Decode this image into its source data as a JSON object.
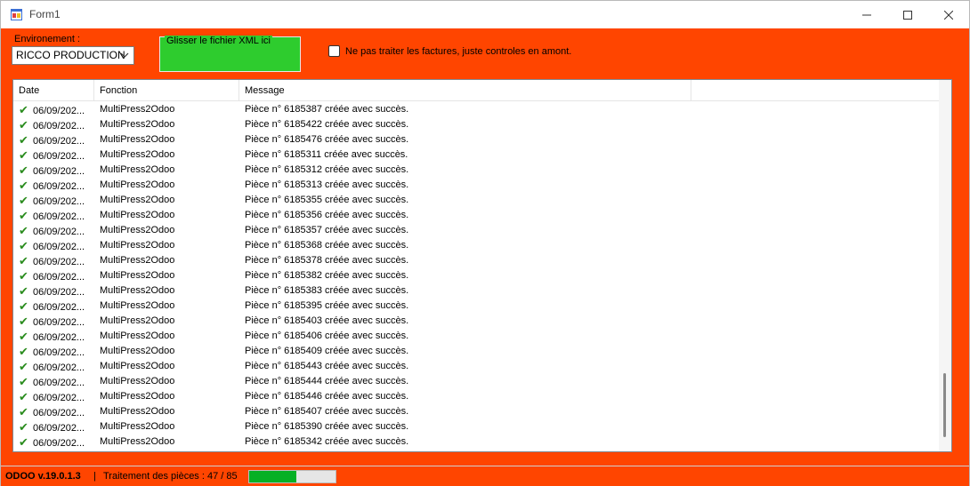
{
  "window": {
    "title": "Form1"
  },
  "controls": {
    "environment_label": "Environement :",
    "environment_value": "RICCO PRODUCTION",
    "drop_zone_label": "Glisser le fichier XML ici",
    "checkbox_label": "Ne pas traiter les factures, juste controles en amont."
  },
  "log_table": {
    "columns": [
      "Date",
      "Fonction",
      "Message"
    ],
    "rows": [
      {
        "date": "06/09/202...",
        "function": "MultiPress2Odoo",
        "message": "Pièce n° 6185387 créée avec succès."
      },
      {
        "date": "06/09/202...",
        "function": "MultiPress2Odoo",
        "message": "Pièce n° 6185422 créée avec succès."
      },
      {
        "date": "06/09/202...",
        "function": "MultiPress2Odoo",
        "message": "Pièce n° 6185476 créée avec succès."
      },
      {
        "date": "06/09/202...",
        "function": "MultiPress2Odoo",
        "message": "Pièce n° 6185311 créée avec succès."
      },
      {
        "date": "06/09/202...",
        "function": "MultiPress2Odoo",
        "message": "Pièce n° 6185312 créée avec succès."
      },
      {
        "date": "06/09/202...",
        "function": "MultiPress2Odoo",
        "message": "Pièce n° 6185313 créée avec succès."
      },
      {
        "date": "06/09/202...",
        "function": "MultiPress2Odoo",
        "message": "Pièce n° 6185355 créée avec succès."
      },
      {
        "date": "06/09/202...",
        "function": "MultiPress2Odoo",
        "message": "Pièce n° 6185356 créée avec succès."
      },
      {
        "date": "06/09/202...",
        "function": "MultiPress2Odoo",
        "message": "Pièce n° 6185357 créée avec succès."
      },
      {
        "date": "06/09/202...",
        "function": "MultiPress2Odoo",
        "message": "Pièce n° 6185368 créée avec succès."
      },
      {
        "date": "06/09/202...",
        "function": "MultiPress2Odoo",
        "message": "Pièce n° 6185378 créée avec succès."
      },
      {
        "date": "06/09/202...",
        "function": "MultiPress2Odoo",
        "message": "Pièce n° 6185382 créée avec succès."
      },
      {
        "date": "06/09/202...",
        "function": "MultiPress2Odoo",
        "message": "Pièce n° 6185383 créée avec succès."
      },
      {
        "date": "06/09/202...",
        "function": "MultiPress2Odoo",
        "message": "Pièce n° 6185395 créée avec succès."
      },
      {
        "date": "06/09/202...",
        "function": "MultiPress2Odoo",
        "message": "Pièce n° 6185403 créée avec succès."
      },
      {
        "date": "06/09/202...",
        "function": "MultiPress2Odoo",
        "message": "Pièce n° 6185406 créée avec succès."
      },
      {
        "date": "06/09/202...",
        "function": "MultiPress2Odoo",
        "message": "Pièce n° 6185409 créée avec succès."
      },
      {
        "date": "06/09/202...",
        "function": "MultiPress2Odoo",
        "message": "Pièce n° 6185443 créée avec succès."
      },
      {
        "date": "06/09/202...",
        "function": "MultiPress2Odoo",
        "message": "Pièce n° 6185444 créée avec succès."
      },
      {
        "date": "06/09/202...",
        "function": "MultiPress2Odoo",
        "message": "Pièce n° 6185446 créée avec succès."
      },
      {
        "date": "06/09/202...",
        "function": "MultiPress2Odoo",
        "message": "Pièce n° 6185407 créée avec succès."
      },
      {
        "date": "06/09/202...",
        "function": "MultiPress2Odoo",
        "message": "Pièce n° 6185390 créée avec succès."
      },
      {
        "date": "06/09/202...",
        "function": "MultiPress2Odoo",
        "message": "Pièce n° 6185342 créée avec succès."
      }
    ],
    "row_icon": "checkmark-icon"
  },
  "status": {
    "version": "ODOO v.19.0.1.3",
    "separator": "|",
    "progress_text": "Traitement des pièces : 47 / 85",
    "progress_fraction": 0.55
  },
  "colors": {
    "background": "#ff4500",
    "drop_zone": "#2ecc2e",
    "check": "#2a8c1e",
    "progress": "#06b025"
  },
  "icons": {
    "app": "app-window-icon",
    "minimize": "minimize-icon",
    "maximize": "maximize-icon",
    "close": "close-icon",
    "dropdown": "chevron-down-icon"
  }
}
